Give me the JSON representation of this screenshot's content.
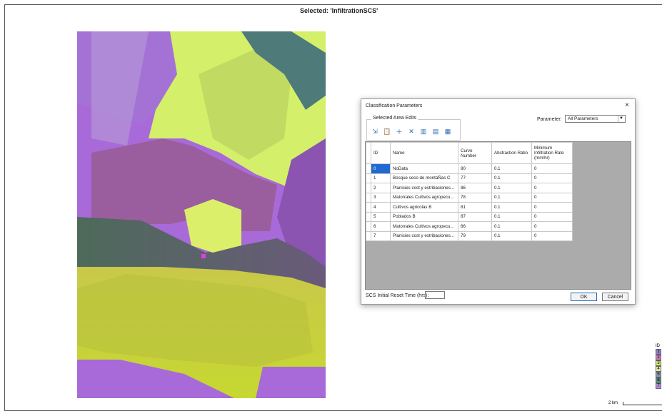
{
  "header": {
    "selected_title": "Selected: 'InfiltrationSCS'"
  },
  "dialog": {
    "title": "Classification Parameters",
    "close_label": "×",
    "area_edits_label": "Selected Area Edits",
    "tool_icons": [
      "import-icon",
      "clipboard-icon",
      "add-icon",
      "delete-icon",
      "column-chart-icon",
      "save-icon",
      "bar-chart-icon"
    ],
    "parameter_label": "Parameter:",
    "parameter_value": "All Parameters",
    "columns": {
      "id": "ID",
      "name": "Name",
      "curve_number": "Curve Number",
      "abstraction_ratio": "Abstraction Ratio",
      "min_infiltration": "Minimum Infiltration Rate (mm/hr)"
    },
    "rows": [
      {
        "id": "0",
        "name": "NoData",
        "cn": "80",
        "ar": "0.1",
        "mi": "0"
      },
      {
        "id": "1",
        "name": "Bosque seco de montaÑas C",
        "cn": "77",
        "ar": "0.1",
        "mi": "0"
      },
      {
        "id": "2",
        "name": "Planicies cost  y estribaciones...",
        "cn": "86",
        "ar": "0.1",
        "mi": "0"
      },
      {
        "id": "3",
        "name": "Matorrales  Cultivos agropecu...",
        "cn": "78",
        "ar": "0.1",
        "mi": "0"
      },
      {
        "id": "4",
        "name": "Cultivos agricolas B",
        "cn": "81",
        "ar": "0.1",
        "mi": "0"
      },
      {
        "id": "5",
        "name": "Poblados B",
        "cn": "87",
        "ar": "0.1",
        "mi": "0"
      },
      {
        "id": "6",
        "name": "Matorrales  Cultivos agropecu...",
        "cn": "66",
        "ar": "0.1",
        "mi": "0"
      },
      {
        "id": "7",
        "name": "Planicies cost  y estribaciones...",
        "cn": "79",
        "ar": "0.1",
        "mi": "0"
      }
    ],
    "reset_time_label": "SCS Initial Reset Time (hrs):",
    "reset_time_value": "",
    "ok_label": "OK",
    "cancel_label": "Cancel"
  },
  "legend": {
    "header": "ID",
    "items": [
      {
        "label": "1",
        "color": "#9b7bc9"
      },
      {
        "label": "2",
        "color": "#c97bc9"
      },
      {
        "label": "3",
        "color": "#d8e86a"
      },
      {
        "label": "4",
        "color": "#e3eda8"
      },
      {
        "label": "5",
        "color": "#8a9bb5"
      },
      {
        "label": "6",
        "color": "#5a8a8a"
      },
      {
        "label": "7",
        "color": "#b58ad8"
      }
    ]
  },
  "scale": {
    "label": "2 km"
  },
  "colors": {
    "accent": "#1f6ad0",
    "purple": "#a66ad6",
    "yellow_green": "#d6f05a",
    "teal": "#3f6e6e"
  }
}
